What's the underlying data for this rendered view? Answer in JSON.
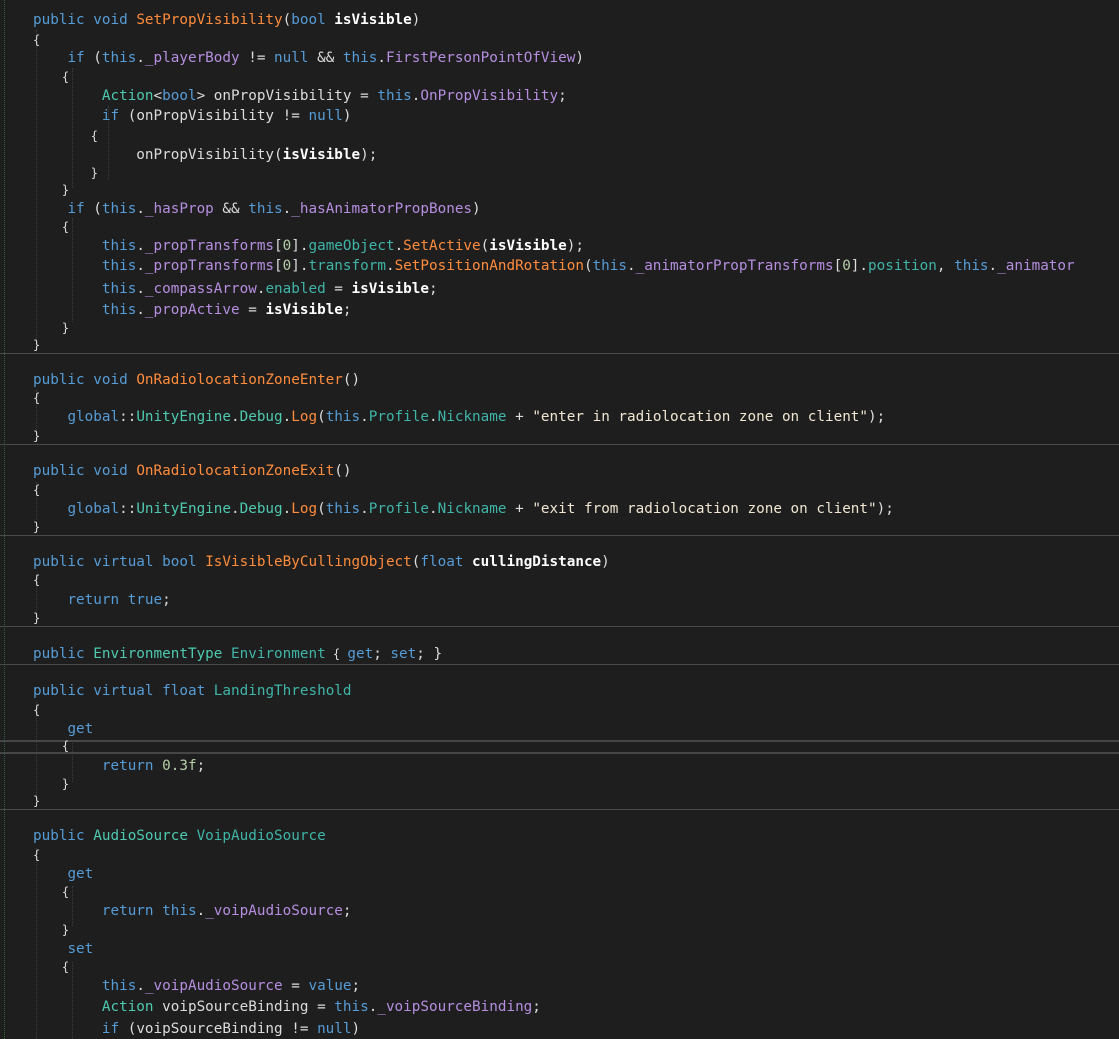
{
  "editor": {
    "background": "#1e1e1e",
    "token_colors": {
      "kw": "#569cd6",
      "mt": "#ff8c3c",
      "fd": "#b58ee0",
      "pr": "#3fb5a8",
      "ty": "#4ec9b0",
      "lc": "#dcdcdc",
      "pa": "#ffffff",
      "st": "#f0e6d2",
      "nm": "#b5cea8"
    },
    "lines": [
      {
        "t": [
          [
            "kw",
            "public"
          ],
          [
            "pn",
            " "
          ],
          [
            "kw",
            "void"
          ],
          [
            "pn",
            " "
          ],
          [
            "mt",
            "SetPropVisibility"
          ],
          [
            "pn",
            "("
          ],
          [
            "kw",
            "bool"
          ],
          [
            "pn",
            " "
          ],
          [
            "pa",
            "isVisible"
          ],
          [
            "pn",
            ")"
          ]
        ]
      },
      {
        "t": [
          [
            "pn",
            "{"
          ]
        ]
      },
      {
        "t": [
          [
            "pn",
            "    "
          ],
          [
            "kw",
            "if"
          ],
          [
            "pn",
            " ("
          ],
          [
            "kw",
            "this"
          ],
          [
            "pn",
            "."
          ],
          [
            "fd",
            "_playerBody"
          ],
          [
            "pn",
            " != "
          ],
          [
            "kw",
            "null"
          ],
          [
            "pn",
            " && "
          ],
          [
            "kw",
            "this"
          ],
          [
            "pn",
            "."
          ],
          [
            "fd",
            "FirstPersonPointOfView"
          ],
          [
            "pn",
            ")"
          ]
        ]
      },
      {
        "t": [
          [
            "pn",
            "    {"
          ]
        ]
      },
      {
        "t": [
          [
            "pn",
            "        "
          ],
          [
            "ty",
            "Action"
          ],
          [
            "pn",
            "<"
          ],
          [
            "kw",
            "bool"
          ],
          [
            "pn",
            "> "
          ],
          [
            "lc",
            "onPropVisibility"
          ],
          [
            "pn",
            " = "
          ],
          [
            "kw",
            "this"
          ],
          [
            "pn",
            "."
          ],
          [
            "fd",
            "OnPropVisibility"
          ],
          [
            "pn",
            ";"
          ]
        ]
      },
      {
        "t": [
          [
            "pn",
            "        "
          ],
          [
            "kw",
            "if"
          ],
          [
            "pn",
            " ("
          ],
          [
            "lc",
            "onPropVisibility"
          ],
          [
            "pn",
            " != "
          ],
          [
            "kw",
            "null"
          ],
          [
            "pn",
            ")"
          ]
        ]
      },
      {
        "t": [
          [
            "pn",
            "        {"
          ]
        ]
      },
      {
        "t": [
          [
            "pn",
            "            "
          ],
          [
            "lc",
            "onPropVisibility"
          ],
          [
            "pn",
            "("
          ],
          [
            "pa",
            "isVisible"
          ],
          [
            "pn",
            ");"
          ]
        ]
      },
      {
        "t": [
          [
            "pn",
            "        }"
          ]
        ]
      },
      {
        "t": [
          [
            "pn",
            "    }"
          ]
        ]
      },
      {
        "t": [
          [
            "pn",
            "    "
          ],
          [
            "kw",
            "if"
          ],
          [
            "pn",
            " ("
          ],
          [
            "kw",
            "this"
          ],
          [
            "pn",
            "."
          ],
          [
            "fd",
            "_hasProp"
          ],
          [
            "pn",
            " && "
          ],
          [
            "kw",
            "this"
          ],
          [
            "pn",
            "."
          ],
          [
            "fd",
            "_hasAnimatorPropBones"
          ],
          [
            "pn",
            ")"
          ]
        ]
      },
      {
        "t": [
          [
            "pn",
            "    {"
          ]
        ]
      },
      {
        "t": [
          [
            "pn",
            "        "
          ],
          [
            "kw",
            "this"
          ],
          [
            "pn",
            "."
          ],
          [
            "fd",
            "_propTransforms"
          ],
          [
            "pn",
            "["
          ],
          [
            "nm",
            "0"
          ],
          [
            "pn",
            "]."
          ],
          [
            "pr",
            "gameObject"
          ],
          [
            "pn",
            "."
          ],
          [
            "mt",
            "SetActive"
          ],
          [
            "pn",
            "("
          ],
          [
            "pa",
            "isVisible"
          ],
          [
            "pn",
            ");"
          ]
        ]
      },
      {
        "t": [
          [
            "pn",
            "        "
          ],
          [
            "kw",
            "this"
          ],
          [
            "pn",
            "."
          ],
          [
            "fd",
            "_propTransforms"
          ],
          [
            "pn",
            "["
          ],
          [
            "nm",
            "0"
          ],
          [
            "pn",
            "]."
          ],
          [
            "pr",
            "transform"
          ],
          [
            "pn",
            "."
          ],
          [
            "mt",
            "SetPositionAndRotation"
          ],
          [
            "pn",
            "("
          ],
          [
            "kw",
            "this"
          ],
          [
            "pn",
            "."
          ],
          [
            "fd",
            "_animatorPropTransforms"
          ],
          [
            "pn",
            "["
          ],
          [
            "nm",
            "0"
          ],
          [
            "pn",
            "]."
          ],
          [
            "pr",
            "position"
          ],
          [
            "pn",
            ", "
          ],
          [
            "kw",
            "this"
          ],
          [
            "pn",
            "."
          ],
          [
            "fd",
            "_animator"
          ]
        ]
      },
      {
        "t": [
          [
            "pn",
            "        "
          ],
          [
            "kw",
            "this"
          ],
          [
            "pn",
            "."
          ],
          [
            "fd",
            "_compassArrow"
          ],
          [
            "pn",
            "."
          ],
          [
            "pr",
            "enabled"
          ],
          [
            "pn",
            " = "
          ],
          [
            "pa",
            "isVisible"
          ],
          [
            "pn",
            ";"
          ]
        ]
      },
      {
        "t": [
          [
            "pn",
            "        "
          ],
          [
            "kw",
            "this"
          ],
          [
            "pn",
            "."
          ],
          [
            "fd",
            "_propActive"
          ],
          [
            "pn",
            " = "
          ],
          [
            "pa",
            "isVisible"
          ],
          [
            "pn",
            ";"
          ]
        ]
      },
      {
        "t": [
          [
            "pn",
            "    }"
          ]
        ]
      },
      {
        "t": [
          [
            "pn",
            "}"
          ]
        ]
      },
      {
        "t": [
          [
            "kw",
            "public"
          ],
          [
            "pn",
            " "
          ],
          [
            "kw",
            "void"
          ],
          [
            "pn",
            " "
          ],
          [
            "mt",
            "OnRadiolocationZoneEnter"
          ],
          [
            "pn",
            "()"
          ]
        ]
      },
      {
        "t": [
          [
            "pn",
            "{"
          ]
        ]
      },
      {
        "t": [
          [
            "pn",
            "    "
          ],
          [
            "kw",
            "global"
          ],
          [
            "pn",
            "::"
          ],
          [
            "ty",
            "UnityEngine"
          ],
          [
            "pn",
            "."
          ],
          [
            "ty",
            "Debug"
          ],
          [
            "pn",
            "."
          ],
          [
            "mt",
            "Log"
          ],
          [
            "pn",
            "("
          ],
          [
            "kw",
            "this"
          ],
          [
            "pn",
            "."
          ],
          [
            "pr",
            "Profile"
          ],
          [
            "pn",
            "."
          ],
          [
            "pr",
            "Nickname"
          ],
          [
            "pn",
            " + "
          ],
          [
            "st",
            "\"enter in radiolocation zone on client\""
          ],
          [
            "pn",
            ");"
          ]
        ]
      },
      {
        "t": [
          [
            "pn",
            "}"
          ]
        ]
      },
      {
        "t": [
          [
            "kw",
            "public"
          ],
          [
            "pn",
            " "
          ],
          [
            "kw",
            "void"
          ],
          [
            "pn",
            " "
          ],
          [
            "mt",
            "OnRadiolocationZoneExit"
          ],
          [
            "pn",
            "()"
          ]
        ]
      },
      {
        "t": [
          [
            "pn",
            "{"
          ]
        ]
      },
      {
        "t": [
          [
            "pn",
            "    "
          ],
          [
            "kw",
            "global"
          ],
          [
            "pn",
            "::"
          ],
          [
            "ty",
            "UnityEngine"
          ],
          [
            "pn",
            "."
          ],
          [
            "ty",
            "Debug"
          ],
          [
            "pn",
            "."
          ],
          [
            "mt",
            "Log"
          ],
          [
            "pn",
            "("
          ],
          [
            "kw",
            "this"
          ],
          [
            "pn",
            "."
          ],
          [
            "pr",
            "Profile"
          ],
          [
            "pn",
            "."
          ],
          [
            "pr",
            "Nickname"
          ],
          [
            "pn",
            " + "
          ],
          [
            "st",
            "\"exit from radiolocation zone on client\""
          ],
          [
            "pn",
            ");"
          ]
        ]
      },
      {
        "t": [
          [
            "pn",
            "}"
          ]
        ]
      },
      {
        "t": [
          [
            "kw",
            "public"
          ],
          [
            "pn",
            " "
          ],
          [
            "kw",
            "virtual"
          ],
          [
            "pn",
            " "
          ],
          [
            "kw",
            "bool"
          ],
          [
            "pn",
            " "
          ],
          [
            "mt",
            "IsVisibleByCullingObject"
          ],
          [
            "pn",
            "("
          ],
          [
            "kw",
            "float"
          ],
          [
            "pn",
            " "
          ],
          [
            "pa",
            "cullingDistance"
          ],
          [
            "pn",
            ")"
          ]
        ]
      },
      {
        "t": [
          [
            "pn",
            "{"
          ]
        ]
      },
      {
        "t": [
          [
            "pn",
            "    "
          ],
          [
            "kw",
            "return"
          ],
          [
            "pn",
            " "
          ],
          [
            "kw",
            "true"
          ],
          [
            "pn",
            ";"
          ]
        ]
      },
      {
        "t": [
          [
            "pn",
            "}"
          ]
        ]
      },
      {
        "t": [
          [
            "kw",
            "public"
          ],
          [
            "pn",
            " "
          ],
          [
            "ty",
            "EnvironmentType"
          ],
          [
            "pn",
            " "
          ],
          [
            "pr",
            "Environment"
          ],
          [
            "pn",
            " { "
          ],
          [
            "kw",
            "get"
          ],
          [
            "pn",
            "; "
          ],
          [
            "kw",
            "set"
          ],
          [
            "pn",
            "; }"
          ]
        ]
      },
      {
        "t": [
          [
            "kw",
            "public"
          ],
          [
            "pn",
            " "
          ],
          [
            "kw",
            "virtual"
          ],
          [
            "pn",
            " "
          ],
          [
            "kw",
            "float"
          ],
          [
            "pn",
            " "
          ],
          [
            "pr",
            "LandingThreshold"
          ]
        ]
      },
      {
        "t": [
          [
            "pn",
            "{"
          ]
        ]
      },
      {
        "t": [
          [
            "pn",
            "    "
          ],
          [
            "kw",
            "get"
          ]
        ]
      },
      {
        "t": [
          [
            "pn",
            "    {"
          ]
        ]
      },
      {
        "t": [
          [
            "pn",
            "        "
          ],
          [
            "kw",
            "return"
          ],
          [
            "pn",
            " "
          ],
          [
            "nm",
            "0.3f"
          ],
          [
            "pn",
            ";"
          ]
        ]
      },
      {
        "t": [
          [
            "pn",
            "    }"
          ]
        ]
      },
      {
        "t": [
          [
            "pn",
            "}"
          ]
        ]
      },
      {
        "t": [
          [
            "kw",
            "public"
          ],
          [
            "pn",
            " "
          ],
          [
            "ty",
            "AudioSource"
          ],
          [
            "pn",
            " "
          ],
          [
            "pr",
            "VoipAudioSource"
          ]
        ]
      },
      {
        "t": [
          [
            "pn",
            "{"
          ]
        ]
      },
      {
        "t": [
          [
            "pn",
            "    "
          ],
          [
            "kw",
            "get"
          ]
        ]
      },
      {
        "t": [
          [
            "pn",
            "    {"
          ]
        ]
      },
      {
        "t": [
          [
            "pn",
            "        "
          ],
          [
            "kw",
            "return"
          ],
          [
            "pn",
            " "
          ],
          [
            "kw",
            "this"
          ],
          [
            "pn",
            "."
          ],
          [
            "fd",
            "_voipAudioSource"
          ],
          [
            "pn",
            ";"
          ]
        ]
      },
      {
        "t": [
          [
            "pn",
            "    }"
          ]
        ]
      },
      {
        "t": [
          [
            "pn",
            "    "
          ],
          [
            "kw",
            "set"
          ]
        ]
      },
      {
        "t": [
          [
            "pn",
            "    {"
          ]
        ]
      },
      {
        "t": [
          [
            "pn",
            "        "
          ],
          [
            "kw",
            "this"
          ],
          [
            "pn",
            "."
          ],
          [
            "fd",
            "_voipAudioSource"
          ],
          [
            "pn",
            " = "
          ],
          [
            "kw",
            "value"
          ],
          [
            "pn",
            ";"
          ]
        ]
      },
      {
        "t": [
          [
            "pn",
            "        "
          ],
          [
            "ty",
            "Action"
          ],
          [
            "pn",
            " "
          ],
          [
            "lc",
            "voipSourceBinding"
          ],
          [
            "pn",
            " = "
          ],
          [
            "kw",
            "this"
          ],
          [
            "pn",
            "."
          ],
          [
            "fd",
            "_voipSourceBinding"
          ],
          [
            "pn",
            ";"
          ]
        ]
      },
      {
        "t": [
          [
            "pn",
            "        "
          ],
          [
            "kw",
            "if"
          ],
          [
            "pn",
            " ("
          ],
          [
            "lc",
            "voipSourceBinding"
          ],
          [
            "pn",
            " != "
          ],
          [
            "kw",
            "null"
          ],
          [
            "pn",
            ")"
          ]
        ]
      }
    ]
  }
}
